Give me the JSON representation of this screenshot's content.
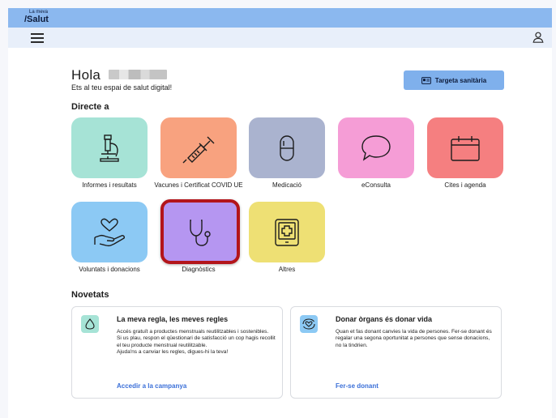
{
  "header": {
    "logo_top": "La meva",
    "logo_main": "/Salut"
  },
  "greeting": {
    "hello": "Hola",
    "subtitle": "Ets al teu espai de salut digital!"
  },
  "health_card_button": {
    "label": "Targeta sanitària"
  },
  "direct_access": {
    "heading": "Directe a",
    "tiles": [
      {
        "label": "Informes i resultats",
        "color": "#a6e3d6",
        "icon": "microscope-icon"
      },
      {
        "label": "Vacunes i Certificat COVID UE",
        "color": "#f8a27f",
        "icon": "syringe-icon"
      },
      {
        "label": "Medicació",
        "color": "#aab3cf",
        "icon": "pill-icon"
      },
      {
        "label": "eConsulta",
        "color": "#f59dd6",
        "icon": "chat-bubble-icon"
      },
      {
        "label": "Cites i agenda",
        "color": "#f57f80",
        "icon": "calendar-icon"
      },
      {
        "label": "Voluntats i donacions",
        "color": "#8cc9f4",
        "icon": "heart-hand-icon"
      },
      {
        "label": "Diagnòstics",
        "color": "#b596f1",
        "icon": "stethoscope-icon"
      },
      {
        "label": "Altres",
        "color": "#eee074",
        "icon": "tablet-plus-icon"
      }
    ]
  },
  "news": {
    "heading": "Novetats",
    "cards": [
      {
        "title": "La meva regla, les meves regles",
        "body": "Accés gratuït a productes menstruals reutilitzables i sostenibles.\nSi us plau, respon el qüestionari de satisfacció un cop hagis recollit el teu producte menstrual reutilitzable.\nAjuda'ns a canviar les regles, digues-hi la teva!",
        "link": "Accedir a la campanya",
        "badge_color": "#a6e3d6",
        "icon": "drop-icon"
      },
      {
        "title": "Donar òrgans és donar vida",
        "body": "Quan et fas donant canvies la vida de persones. Fer-se donant és regalar una segona oportunitat a persones que sense donacions, no la tindrien.",
        "link": "Fer-se donant",
        "badge_color": "#8cc9f4",
        "icon": "heart-cycle-icon"
      }
    ]
  },
  "colors": {
    "topbar": "#8bb8ef",
    "navbar": "#e8effa",
    "accent_button": "#7fb0ec",
    "link": "#3a6fd8",
    "selection": "#b3151b"
  }
}
